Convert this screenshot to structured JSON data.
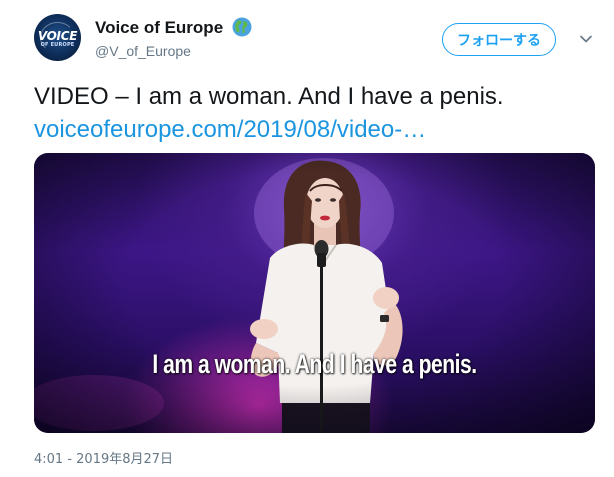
{
  "author": {
    "display_name": "Voice of Europe",
    "handle": "@V_of_Europe",
    "avatar_logo_top": "VOICE",
    "avatar_logo_bottom": "OF EUROPE",
    "name_emoji_icon": "globe-europe-icon"
  },
  "actions": {
    "follow_label": "フォローする",
    "menu_icon": "chevron-down-icon"
  },
  "tweet": {
    "text": "VIDEO – I am a woman. And I have a penis.",
    "link": "voiceofeurope.com/2019/08/video-…"
  },
  "media": {
    "type": "video-thumbnail",
    "caption": "I am a woman. And I have a penis."
  },
  "meta": {
    "timestamp": "4:01 - 2019年8月27日"
  },
  "colors": {
    "accent": "#1da1f2",
    "link": "#1b95e0",
    "text": "#14171a",
    "secondary": "#657786"
  }
}
